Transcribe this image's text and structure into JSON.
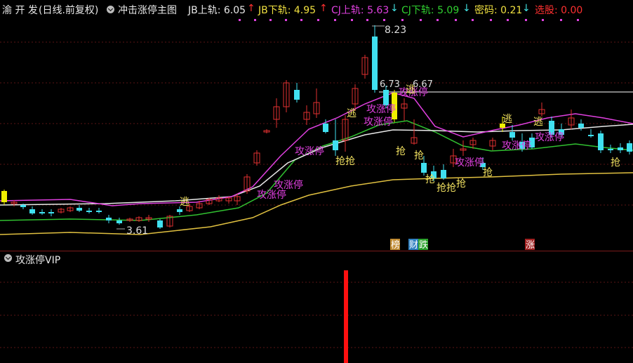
{
  "header": {
    "stock_name": "渝 开 发",
    "period": "(日线.前复权)",
    "indicator_name": "冲击涨停主图",
    "jb_upper_label": "JB上轨: 6.05",
    "jb_upper_arrow": "↑",
    "jb_lower_label": "JB下轨: 4.95",
    "jb_lower_arrow": "↑",
    "cj_upper_label": "CJ上轨: 5.63",
    "cj_upper_arrow": "↓",
    "cj_lower_label": "CJ下轨: 5.09",
    "cj_lower_arrow": "↓",
    "code_label": "密码: 0.21",
    "code_arrow": "↓",
    "select_label": "选股: 0.00"
  },
  "main_chart": {
    "price_high_label": "8.23",
    "price_low_label": "3.61",
    "level_left_label": "6.73",
    "level_right_label": "6.67",
    "signals": {
      "attack": "攻涨停",
      "escape": "逃",
      "grab": "抢"
    },
    "badges": {
      "bang": "榜",
      "cai": "财",
      "die": "跌",
      "zhang": "涨"
    }
  },
  "sub_chart": {
    "title": "攻涨停VIP"
  },
  "colors": {
    "background": "#000000",
    "up_candle": "#e03030",
    "down_candle": "#40e0f0",
    "ma_magenta": "#e040e0",
    "ma_white": "#e8e8e8",
    "ma_green": "#30c030",
    "ma_yellow": "#e0c040",
    "grid": "#5a1515",
    "signal_yellow": "#f0f000",
    "attack_text": "#e040e0",
    "escape_text": "#f0e060",
    "grab_text": "#f0e060",
    "sub_bar": "#ff1010"
  },
  "icons": {
    "indicator_menu": "gear-icon",
    "sub_menu": "gear-icon"
  }
}
